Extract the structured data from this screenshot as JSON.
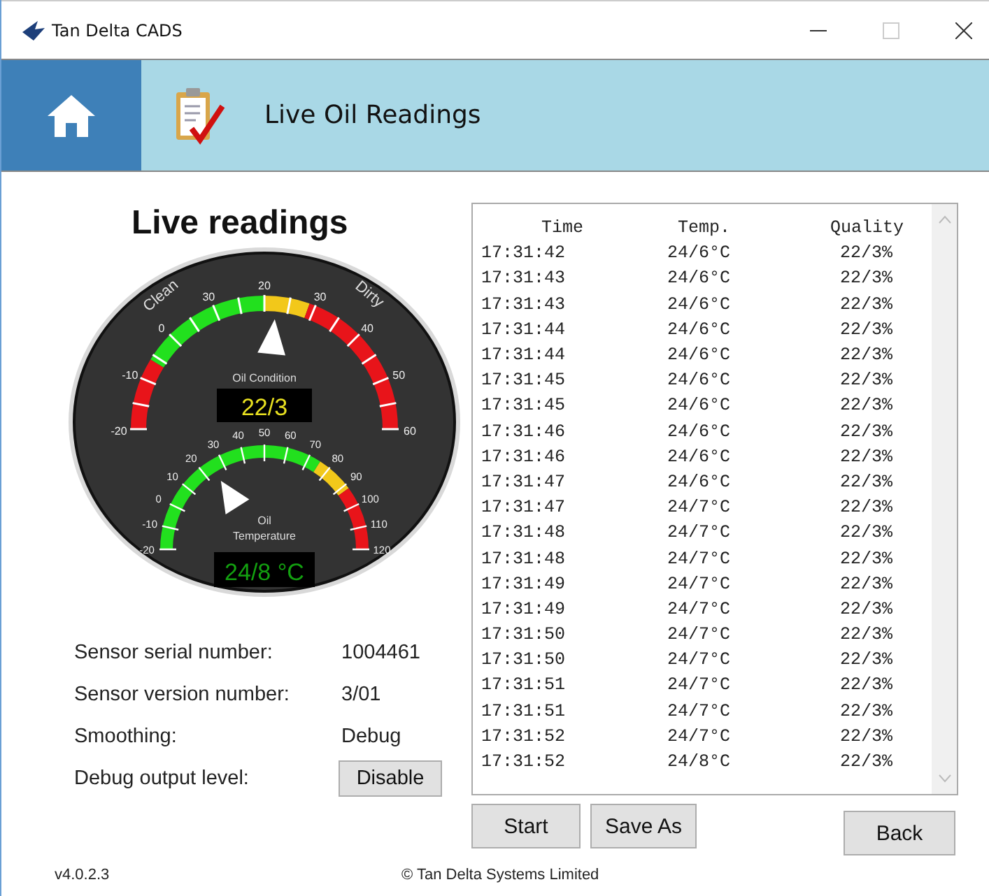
{
  "window": {
    "title": "Tan Delta CADS"
  },
  "header": {
    "title": "Live Oil Readings"
  },
  "heading": "Live readings",
  "condition_gauge": {
    "labels": [
      "-20",
      "-10",
      "0",
      "30",
      "20",
      "30",
      "40",
      "50",
      "60"
    ],
    "left_caption": "Clean",
    "right_caption": "Dirty",
    "caption": "Oil Condition",
    "reading": "22/3"
  },
  "temperature_gauge": {
    "labels": [
      "-20",
      "-10",
      "0",
      "10",
      "20",
      "30",
      "40",
      "50",
      "60",
      "70",
      "80",
      "90",
      "100",
      "110",
      "120"
    ],
    "caption_lines": [
      "Oil",
      "Temperature"
    ],
    "reading": "24/8 °C"
  },
  "info": [
    {
      "label": "Sensor serial number:",
      "value": "1004461",
      "kind": "text"
    },
    {
      "label": "Sensor version number:",
      "value": "3/01",
      "kind": "text"
    },
    {
      "label": "Smoothing:",
      "value": "Debug",
      "kind": "text"
    },
    {
      "label": "Debug output level:",
      "value": "Disable",
      "kind": "button"
    }
  ],
  "readings": {
    "columns": [
      "Time",
      "Temp.",
      "Quality"
    ],
    "rows": [
      [
        "17:31:42",
        "24/6°C",
        "22/3%"
      ],
      [
        "17:31:43",
        "24/6°C",
        "22/3%"
      ],
      [
        "17:31:43",
        "24/6°C",
        "22/3%"
      ],
      [
        "17:31:44",
        "24/6°C",
        "22/3%"
      ],
      [
        "17:31:44",
        "24/6°C",
        "22/3%"
      ],
      [
        "17:31:45",
        "24/6°C",
        "22/3%"
      ],
      [
        "17:31:45",
        "24/6°C",
        "22/3%"
      ],
      [
        "17:31:46",
        "24/6°C",
        "22/3%"
      ],
      [
        "17:31:46",
        "24/6°C",
        "22/3%"
      ],
      [
        "17:31:47",
        "24/6°C",
        "22/3%"
      ],
      [
        "17:31:47",
        "24/7°C",
        "22/3%"
      ],
      [
        "17:31:48",
        "24/7°C",
        "22/3%"
      ],
      [
        "17:31:48",
        "24/7°C",
        "22/3%"
      ],
      [
        "17:31:49",
        "24/7°C",
        "22/3%"
      ],
      [
        "17:31:49",
        "24/7°C",
        "22/3%"
      ],
      [
        "17:31:50",
        "24/7°C",
        "22/3%"
      ],
      [
        "17:31:50",
        "24/7°C",
        "22/3%"
      ],
      [
        "17:31:51",
        "24/7°C",
        "22/3%"
      ],
      [
        "17:31:51",
        "24/7°C",
        "22/3%"
      ],
      [
        "17:31:52",
        "24/7°C",
        "22/3%"
      ],
      [
        "17:31:52",
        "24/8°C",
        "22/3%"
      ]
    ]
  },
  "actions": [
    "Start",
    "Save As"
  ],
  "back_button": "Back",
  "footer": {
    "version": "v4.0.2.3",
    "copyright": "© Tan Delta Systems Limited"
  }
}
